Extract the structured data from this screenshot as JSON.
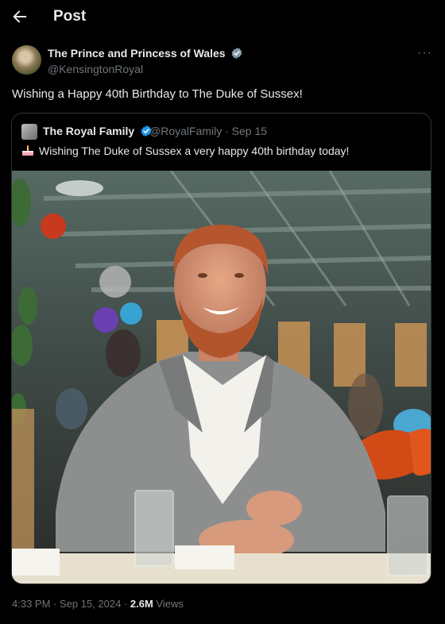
{
  "header": {
    "title": "Post"
  },
  "author": {
    "name": "The Prince and Princess of Wales",
    "handle": "@KensingtonRoyal"
  },
  "tweet": {
    "text": "Wishing a Happy 40th Birthday to The Duke of Sussex!"
  },
  "quote": {
    "name": "The Royal Family",
    "handle_date": "@RoyalFamily · Sep 15",
    "text": "Wishing The Duke of Sussex a very happy 40th birthday today!"
  },
  "meta": {
    "time": "4:33 PM · Sep 15, 2024 · ",
    "views_count": "2.6M",
    "views_label": " Views"
  },
  "colors": {
    "verified_blue": "#1d9bf0",
    "muted": "#71767b",
    "text": "#e7e9ea",
    "border": "#2f3336"
  }
}
